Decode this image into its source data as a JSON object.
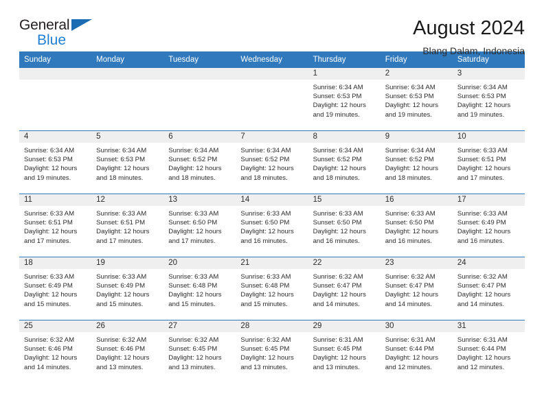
{
  "brand": {
    "name_part1": "General",
    "name_part2": "Blue",
    "triangle_icon": "triangle-icon",
    "accent_color": "#1f7fd4",
    "header_color": "#3079bd"
  },
  "header": {
    "title": "August 2024",
    "subtitle": "Blang Dalam, Indonesia"
  },
  "weekday_headers": [
    "Sunday",
    "Monday",
    "Tuesday",
    "Wednesday",
    "Thursday",
    "Friday",
    "Saturday"
  ],
  "labels": {
    "sunrise": "Sunrise:",
    "sunset": "Sunset:",
    "daylight": "Daylight:"
  },
  "weeks": [
    [
      {
        "day": "",
        "empty": true,
        "line1": "",
        "line2": "",
        "line3": "",
        "line4": ""
      },
      {
        "day": "",
        "empty": true,
        "line1": "",
        "line2": "",
        "line3": "",
        "line4": ""
      },
      {
        "day": "",
        "empty": true,
        "line1": "",
        "line2": "",
        "line3": "",
        "line4": ""
      },
      {
        "day": "",
        "empty": true,
        "line1": "",
        "line2": "",
        "line3": "",
        "line4": ""
      },
      {
        "day": "1",
        "empty": false,
        "line1": "Sunrise: 6:34 AM",
        "line2": "Sunset: 6:53 PM",
        "line3": "Daylight: 12 hours",
        "line4": "and 19 minutes."
      },
      {
        "day": "2",
        "empty": false,
        "line1": "Sunrise: 6:34 AM",
        "line2": "Sunset: 6:53 PM",
        "line3": "Daylight: 12 hours",
        "line4": "and 19 minutes."
      },
      {
        "day": "3",
        "empty": false,
        "line1": "Sunrise: 6:34 AM",
        "line2": "Sunset: 6:53 PM",
        "line3": "Daylight: 12 hours",
        "line4": "and 19 minutes."
      }
    ],
    [
      {
        "day": "4",
        "empty": false,
        "line1": "Sunrise: 6:34 AM",
        "line2": "Sunset: 6:53 PM",
        "line3": "Daylight: 12 hours",
        "line4": "and 19 minutes."
      },
      {
        "day": "5",
        "empty": false,
        "line1": "Sunrise: 6:34 AM",
        "line2": "Sunset: 6:53 PM",
        "line3": "Daylight: 12 hours",
        "line4": "and 18 minutes."
      },
      {
        "day": "6",
        "empty": false,
        "line1": "Sunrise: 6:34 AM",
        "line2": "Sunset: 6:52 PM",
        "line3": "Daylight: 12 hours",
        "line4": "and 18 minutes."
      },
      {
        "day": "7",
        "empty": false,
        "line1": "Sunrise: 6:34 AM",
        "line2": "Sunset: 6:52 PM",
        "line3": "Daylight: 12 hours",
        "line4": "and 18 minutes."
      },
      {
        "day": "8",
        "empty": false,
        "line1": "Sunrise: 6:34 AM",
        "line2": "Sunset: 6:52 PM",
        "line3": "Daylight: 12 hours",
        "line4": "and 18 minutes."
      },
      {
        "day": "9",
        "empty": false,
        "line1": "Sunrise: 6:34 AM",
        "line2": "Sunset: 6:52 PM",
        "line3": "Daylight: 12 hours",
        "line4": "and 18 minutes."
      },
      {
        "day": "10",
        "empty": false,
        "line1": "Sunrise: 6:33 AM",
        "line2": "Sunset: 6:51 PM",
        "line3": "Daylight: 12 hours",
        "line4": "and 17 minutes."
      }
    ],
    [
      {
        "day": "11",
        "empty": false,
        "line1": "Sunrise: 6:33 AM",
        "line2": "Sunset: 6:51 PM",
        "line3": "Daylight: 12 hours",
        "line4": "and 17 minutes."
      },
      {
        "day": "12",
        "empty": false,
        "line1": "Sunrise: 6:33 AM",
        "line2": "Sunset: 6:51 PM",
        "line3": "Daylight: 12 hours",
        "line4": "and 17 minutes."
      },
      {
        "day": "13",
        "empty": false,
        "line1": "Sunrise: 6:33 AM",
        "line2": "Sunset: 6:50 PM",
        "line3": "Daylight: 12 hours",
        "line4": "and 17 minutes."
      },
      {
        "day": "14",
        "empty": false,
        "line1": "Sunrise: 6:33 AM",
        "line2": "Sunset: 6:50 PM",
        "line3": "Daylight: 12 hours",
        "line4": "and 16 minutes."
      },
      {
        "day": "15",
        "empty": false,
        "line1": "Sunrise: 6:33 AM",
        "line2": "Sunset: 6:50 PM",
        "line3": "Daylight: 12 hours",
        "line4": "and 16 minutes."
      },
      {
        "day": "16",
        "empty": false,
        "line1": "Sunrise: 6:33 AM",
        "line2": "Sunset: 6:50 PM",
        "line3": "Daylight: 12 hours",
        "line4": "and 16 minutes."
      },
      {
        "day": "17",
        "empty": false,
        "line1": "Sunrise: 6:33 AM",
        "line2": "Sunset: 6:49 PM",
        "line3": "Daylight: 12 hours",
        "line4": "and 16 minutes."
      }
    ],
    [
      {
        "day": "18",
        "empty": false,
        "line1": "Sunrise: 6:33 AM",
        "line2": "Sunset: 6:49 PM",
        "line3": "Daylight: 12 hours",
        "line4": "and 15 minutes."
      },
      {
        "day": "19",
        "empty": false,
        "line1": "Sunrise: 6:33 AM",
        "line2": "Sunset: 6:49 PM",
        "line3": "Daylight: 12 hours",
        "line4": "and 15 minutes."
      },
      {
        "day": "20",
        "empty": false,
        "line1": "Sunrise: 6:33 AM",
        "line2": "Sunset: 6:48 PM",
        "line3": "Daylight: 12 hours",
        "line4": "and 15 minutes."
      },
      {
        "day": "21",
        "empty": false,
        "line1": "Sunrise: 6:33 AM",
        "line2": "Sunset: 6:48 PM",
        "line3": "Daylight: 12 hours",
        "line4": "and 15 minutes."
      },
      {
        "day": "22",
        "empty": false,
        "line1": "Sunrise: 6:32 AM",
        "line2": "Sunset: 6:47 PM",
        "line3": "Daylight: 12 hours",
        "line4": "and 14 minutes."
      },
      {
        "day": "23",
        "empty": false,
        "line1": "Sunrise: 6:32 AM",
        "line2": "Sunset: 6:47 PM",
        "line3": "Daylight: 12 hours",
        "line4": "and 14 minutes."
      },
      {
        "day": "24",
        "empty": false,
        "line1": "Sunrise: 6:32 AM",
        "line2": "Sunset: 6:47 PM",
        "line3": "Daylight: 12 hours",
        "line4": "and 14 minutes."
      }
    ],
    [
      {
        "day": "25",
        "empty": false,
        "line1": "Sunrise: 6:32 AM",
        "line2": "Sunset: 6:46 PM",
        "line3": "Daylight: 12 hours",
        "line4": "and 14 minutes."
      },
      {
        "day": "26",
        "empty": false,
        "line1": "Sunrise: 6:32 AM",
        "line2": "Sunset: 6:46 PM",
        "line3": "Daylight: 12 hours",
        "line4": "and 13 minutes."
      },
      {
        "day": "27",
        "empty": false,
        "line1": "Sunrise: 6:32 AM",
        "line2": "Sunset: 6:45 PM",
        "line3": "Daylight: 12 hours",
        "line4": "and 13 minutes."
      },
      {
        "day": "28",
        "empty": false,
        "line1": "Sunrise: 6:32 AM",
        "line2": "Sunset: 6:45 PM",
        "line3": "Daylight: 12 hours",
        "line4": "and 13 minutes."
      },
      {
        "day": "29",
        "empty": false,
        "line1": "Sunrise: 6:31 AM",
        "line2": "Sunset: 6:45 PM",
        "line3": "Daylight: 12 hours",
        "line4": "and 13 minutes."
      },
      {
        "day": "30",
        "empty": false,
        "line1": "Sunrise: 6:31 AM",
        "line2": "Sunset: 6:44 PM",
        "line3": "Daylight: 12 hours",
        "line4": "and 12 minutes."
      },
      {
        "day": "31",
        "empty": false,
        "line1": "Sunrise: 6:31 AM",
        "line2": "Sunset: 6:44 PM",
        "line3": "Daylight: 12 hours",
        "line4": "and 12 minutes."
      }
    ]
  ]
}
